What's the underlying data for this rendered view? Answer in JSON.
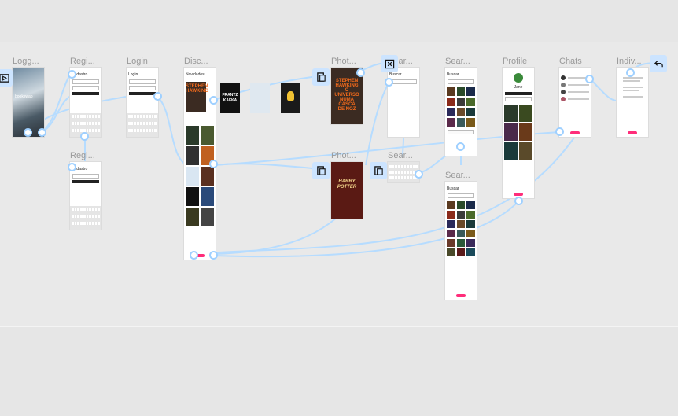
{
  "frame_labels": {
    "logged": "Logg...",
    "register": "Regi...",
    "register2": "Regi...",
    "login": "Login",
    "discover": "Disc...",
    "photo1": "Phot...",
    "photo2": "Phot...",
    "search1": "Sear...",
    "search2": "Sear...",
    "search3": "Sear...",
    "search4": "Sear...",
    "profile": "Profile",
    "chats": "Chats",
    "individual": "Indiv..."
  },
  "frame_text": {
    "register_title": "Cadastro",
    "register2_title": "Cadastro",
    "login_title": "Login",
    "discover_title": "Novidades",
    "search_title": "Buscar",
    "search4_title": "Buscar",
    "profile_name": "Jane",
    "splash_logo": "bookswap"
  },
  "covers": {
    "hawking": [
      "STEPHEN",
      "HAWKING",
      "O UNIVERSO",
      "NUMA CASCA",
      "DE NOZ"
    ],
    "potter": [
      "HARRY",
      "POTTER"
    ],
    "kafka": [
      "FRANTZ",
      "KAFKA"
    ]
  },
  "icons": {
    "present": "play-icon",
    "device": "device-preview-icon",
    "close": "close-icon",
    "back": "back-arrow-icon"
  },
  "colors": {
    "canvas": "#e6e6e6",
    "section": "#e9e9e9",
    "connector": "#9fd0ff",
    "accent": "#ff2d7a"
  }
}
